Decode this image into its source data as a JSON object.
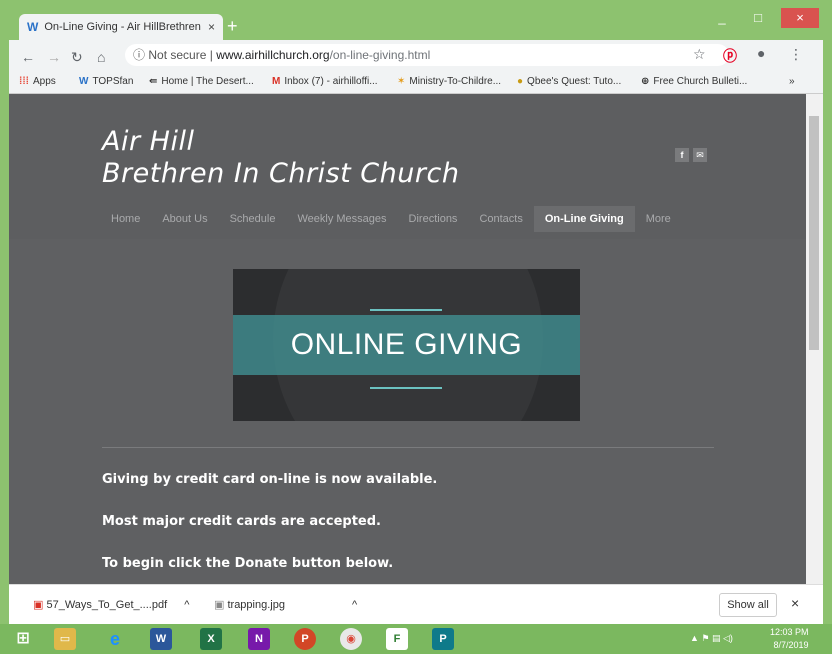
{
  "browser": {
    "tab_title": "On-Line Giving - Air HillBrethren",
    "tab_close": "×",
    "new_tab": "+",
    "url_security": "Not secure",
    "url_host": "www.airhillchurch.org",
    "url_path": "/on-line-giving.html",
    "win_min": "_",
    "win_max": "□",
    "win_close": "×"
  },
  "bookmarks": [
    {
      "label": "Apps",
      "icon": "apps-icon"
    },
    {
      "label": "TOPSfan",
      "icon": "w-icon"
    },
    {
      "label": "Home | The Desert...",
      "icon": "desert-icon"
    },
    {
      "label": "Inbox (7) - airhilloffi...",
      "icon": "gmail-icon"
    },
    {
      "label": "Ministry-To-Childre...",
      "icon": "ministry-icon"
    },
    {
      "label": "Qbee's Quest: Tuto...",
      "icon": "bee-icon"
    },
    {
      "label": "Free Church Bulleti...",
      "icon": "globe-icon"
    }
  ],
  "bookmarks_more": "»",
  "site": {
    "title_line1": "Air Hill",
    "title_line2": "Brethren In Christ Church",
    "social_fb": "f",
    "social_mail": "✉",
    "nav": [
      "Home",
      "About Us",
      "Schedule",
      "Weekly Messages",
      "Directions",
      "Contacts",
      "On-Line Giving",
      "More"
    ],
    "active_nav": "On-Line Giving",
    "banner_text": "ONLINE GIVING",
    "paragraphs": [
      "Giving by credit card on-line is now available.",
      "Most major credit cards are accepted.",
      "To begin click the Donate button below."
    ]
  },
  "downloads": {
    "items": [
      "57_Ways_To_Get_....pdf",
      "trapping.jpg"
    ],
    "show_all": "Show all",
    "close": "×"
  },
  "taskbar": {
    "time": "12:03 PM",
    "date": "8/7/2019"
  }
}
